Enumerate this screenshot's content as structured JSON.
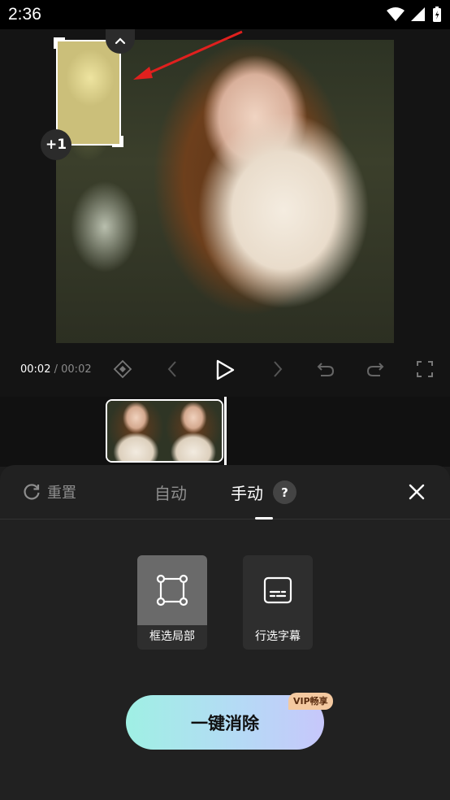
{
  "status_bar": {
    "time": "2:36"
  },
  "preview": {
    "add_badge": "+1"
  },
  "playback": {
    "current_time": "00:02",
    "separator": "/",
    "total_time": "00:02"
  },
  "panel": {
    "reset_label": "重置",
    "tab_auto": "自动",
    "tab_manual": "手动",
    "help_label": "?",
    "tools": [
      {
        "label": "框选局部",
        "icon": "box-select-icon",
        "active": true
      },
      {
        "label": "行选字幕",
        "icon": "subtitle-icon",
        "active": false
      }
    ],
    "primary_button": "一键消除",
    "vip_badge": "VIP畅享"
  },
  "colors": {
    "background": "#1c1c1c",
    "panel": "#212121",
    "arrow": "#e0201e",
    "cta_start": "#9ff0e4",
    "cta_end": "#c7c7fb",
    "vip": "#f4c9a0"
  }
}
